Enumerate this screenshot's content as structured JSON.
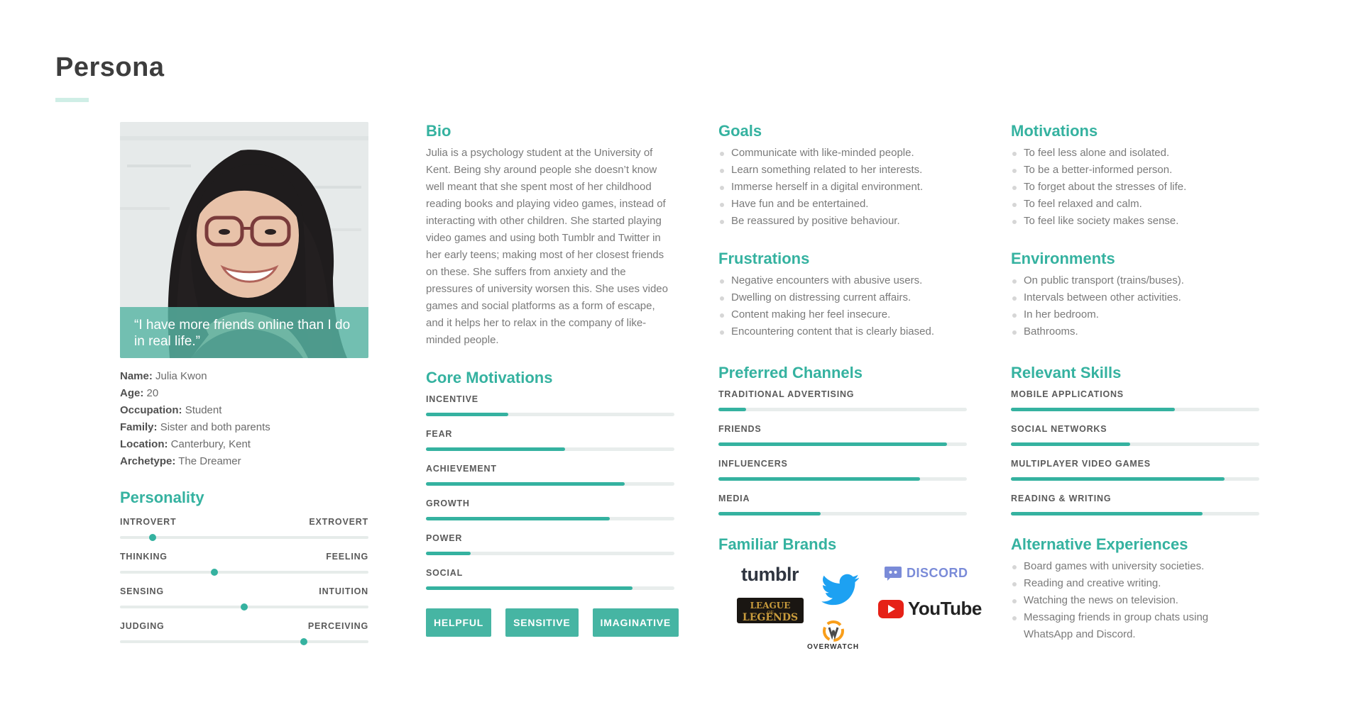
{
  "page": {
    "title": "Persona"
  },
  "profile": {
    "quote": "“I have more friends online than I do in real life.”",
    "fields": [
      {
        "label": "Name:",
        "value": "Julia Kwon"
      },
      {
        "label": "Age:",
        "value": "20"
      },
      {
        "label": "Occupation:",
        "value": "Student"
      },
      {
        "label": "Family:",
        "value": "Sister and both parents"
      },
      {
        "label": "Location:",
        "value": "Canterbury, Kent"
      },
      {
        "label": "Archetype:",
        "value": "The Dreamer"
      }
    ]
  },
  "personality": {
    "heading": "Personality",
    "scales": [
      {
        "left": "INTROVERT",
        "right": "EXTROVERT",
        "value": 0.13
      },
      {
        "left": "THINKING",
        "right": "FEELING",
        "value": 0.38
      },
      {
        "left": "SENSING",
        "right": "INTUITION",
        "value": 0.5
      },
      {
        "left": "JUDGING",
        "right": "PERCEIVING",
        "value": 0.74
      }
    ]
  },
  "bio": {
    "heading": "Bio",
    "text": "Julia is a psychology student at the University of Kent. Being shy around people she doesn’t know well meant that she spent most of her childhood reading books and playing video games, instead of interacting with other children. She started playing video games and using both Tumblr and Twitter in her early teens; making most of her closest friends on these. She suffers from anxiety and the pressures of university worsen this. She uses video games and social platforms as a form of escape, and it helps her to relax in the company of like-minded people."
  },
  "core_motivations": {
    "heading": "Core Motivations",
    "items": [
      {
        "label": "INCENTIVE",
        "value": 0.33
      },
      {
        "label": "FEAR",
        "value": 0.56
      },
      {
        "label": "ACHIEVEMENT",
        "value": 0.8
      },
      {
        "label": "GROWTH",
        "value": 0.74
      },
      {
        "label": "POWER",
        "value": 0.18
      },
      {
        "label": "SOCIAL",
        "value": 0.83
      }
    ]
  },
  "traits": [
    "HELPFUL",
    "SENSITIVE",
    "IMAGINATIVE"
  ],
  "goals": {
    "heading": "Goals",
    "items": [
      "Communicate with like-minded people.",
      "Learn something related to her interests.",
      "Immerse herself in a digital environment.",
      "Have fun and be entertained.",
      "Be reassured by positive behaviour."
    ]
  },
  "frustrations": {
    "heading": "Frustrations",
    "items": [
      "Negative encounters with abusive users.",
      "Dwelling on distressing current affairs.",
      "Content making her feel insecure.",
      "Encountering content that is clearly biased."
    ]
  },
  "preferred_channels": {
    "heading": "Preferred Channels",
    "items": [
      {
        "label": "TRADITIONAL ADVERTISING",
        "value": 0.11
      },
      {
        "label": "FRIENDS",
        "value": 0.92
      },
      {
        "label": "INFLUENCERS",
        "value": 0.81
      },
      {
        "label": "MEDIA",
        "value": 0.41
      }
    ]
  },
  "familiar_brands": {
    "heading": "Familiar Brands",
    "tumblr": "tumblr",
    "discord": "DISCORD",
    "youtube": "YouTube",
    "league_line1": "LEAGUE",
    "league_line2": "LEGENDS",
    "league_of": "OF",
    "overwatch": "OVERWATCH",
    "icons": [
      "tumblr-logo",
      "twitter-bird",
      "discord-logo",
      "league-of-legends-logo",
      "overwatch-logo",
      "youtube-logo"
    ],
    "colors": {
      "twitter": "#1da1f2",
      "youtube": "#e62117",
      "discord": "#7289da",
      "overwatch": "#f99e1a"
    }
  },
  "motivations": {
    "heading": "Motivations",
    "items": [
      "To feel less alone and isolated.",
      "To be a better-informed person.",
      "To forget about the stresses of life.",
      "To feel relaxed and calm.",
      "To feel like society makes sense."
    ]
  },
  "environments": {
    "heading": "Environments",
    "items": [
      "On public transport (trains/buses).",
      "Intervals between other activities.",
      "In her bedroom.",
      "Bathrooms."
    ]
  },
  "relevant_skills": {
    "heading": "Relevant Skills",
    "items": [
      {
        "label": "MOBILE APPLICATIONS",
        "value": 0.66
      },
      {
        "label": "SOCIAL NETWORKS",
        "value": 0.48
      },
      {
        "label": "MULTIPLAYER VIDEO GAMES",
        "value": 0.86
      },
      {
        "label": "READING & WRITING",
        "value": 0.77
      }
    ]
  },
  "alternative_experiences": {
    "heading": "Alternative Experiences",
    "items": [
      "Board games with university societies.",
      "Reading and creative writing.",
      "Watching the news on television.",
      "Messaging friends in group chats using WhatsApp and Discord."
    ]
  },
  "colors": {
    "accent": "#35b2a0",
    "track": "#e8edec",
    "heading_text": "#3d3d3d"
  }
}
